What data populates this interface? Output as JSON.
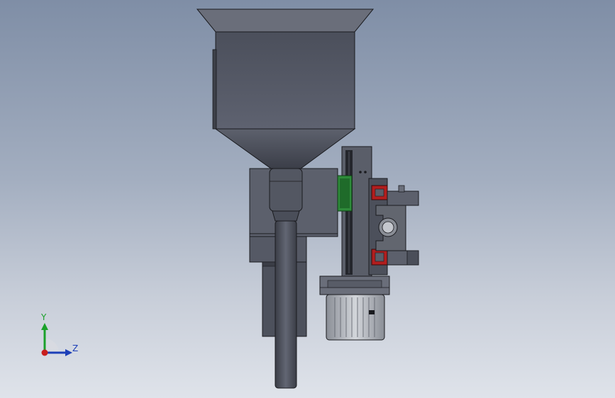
{
  "viewport": {
    "triad": {
      "y_label": "Y",
      "z_label": "Z"
    }
  },
  "colors": {
    "bg_top": "#7f8ea6",
    "bg_bottom": "#dfe3ea",
    "hopper": "#565a67",
    "hopper_dark": "#3f434e",
    "body_gray": "#60646f",
    "tube": "#4f535e",
    "rail_dark": "#23252b",
    "guide_green": "#2e8b3a",
    "seal_red": "#b21e1e",
    "motor_light": "#c4c7cd",
    "axis_y": "#1aa12a",
    "axis_z": "#1c3fb8",
    "axis_x": "#c81e1e"
  }
}
